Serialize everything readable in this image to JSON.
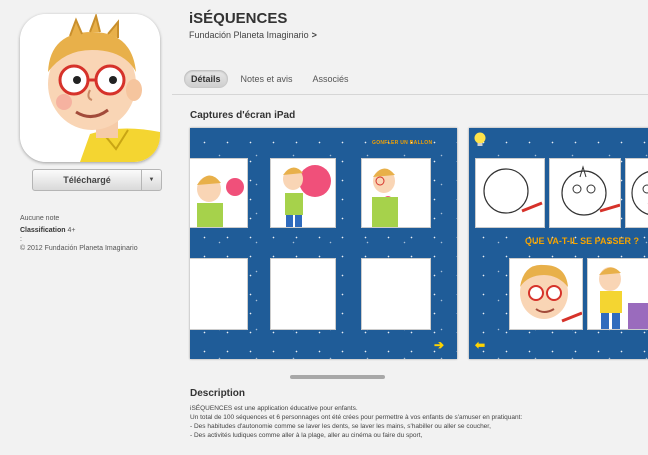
{
  "app": {
    "title": "iSÉQUENCES",
    "developer": "Fundación Planeta Imaginario",
    "developer_chevron": ">"
  },
  "buy": {
    "label": "Téléchargé",
    "arrow": "▼"
  },
  "meta": {
    "rating": "Aucune note",
    "classification_label": "Classification",
    "classification_value": "4+",
    "separator": ":",
    "copyright": "© 2012 Fundación Planeta Imaginario"
  },
  "tabs": [
    {
      "label": "Détails",
      "active": true
    },
    {
      "label": "Notes et avis",
      "active": false
    },
    {
      "label": "Associés",
      "active": false
    }
  ],
  "screenshots": {
    "title": "Captures d'écran iPad",
    "shot1_banner": "GONFLER UN BALLON",
    "shot2_banner": "QUE VA-T-IL SE PASSER ?",
    "next_arrow": "➔",
    "prev_arrow": "⬅"
  },
  "description": {
    "title": "Description",
    "lines": [
      "iSÉQUENCES est une application éducative pour enfants.",
      "Un total de 100 séquences et 6 personnages ont été crées pour permettre à vos enfants de s'amuser en pratiquant:",
      "- Des habitudes d'autonomie comme se laver les dents, se laver les mains, s'habiller ou aller se coucher,",
      "- Des activités ludiques comme aller à la plage, aller au cinéma ou faire du sport,"
    ]
  },
  "colors": {
    "screenshot_bg": "#1f5c98",
    "banner": "#f2a100",
    "balloon": "#f0507a"
  }
}
